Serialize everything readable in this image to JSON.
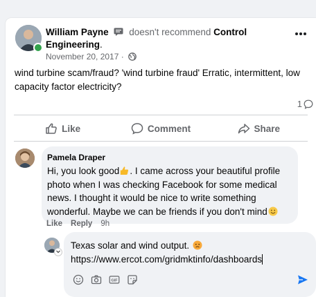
{
  "post": {
    "author": "William Payne",
    "verb": "doesn't recommend",
    "target": "Control Engineering",
    "target_suffix": ".",
    "date": "November 20, 2017",
    "date_separator": "·",
    "body": "wind turbine scam/fraud? 'wind turbine fraud' Erratic, intermittent, low capacity factor electricity?",
    "comment_count": "1",
    "more_icon": "more-horizontal-icon"
  },
  "actions": {
    "like_label": "Like",
    "comment_label": "Comment",
    "share_label": "Share"
  },
  "comment": {
    "author": "Pamela Draper",
    "text_part1": "Hi, you look good",
    "text_part2": ". I came across your beautiful profile photo when I was checking Facebook for some medical news. I thought it would be nice to write something wonderful. Maybe we can be friends if you don't mind",
    "like_label": "Like",
    "reply_label": "Reply",
    "time": "9h"
  },
  "composer": {
    "line1": "Texas solar and wind output.",
    "line2": "https://www.ercot.com/gridmktinfo/dashboards"
  },
  "colors": {
    "accent": "#1877f2",
    "secondary_text": "#65676b",
    "online": "#31a24c",
    "bubble_bg": "#f0f2f5"
  }
}
